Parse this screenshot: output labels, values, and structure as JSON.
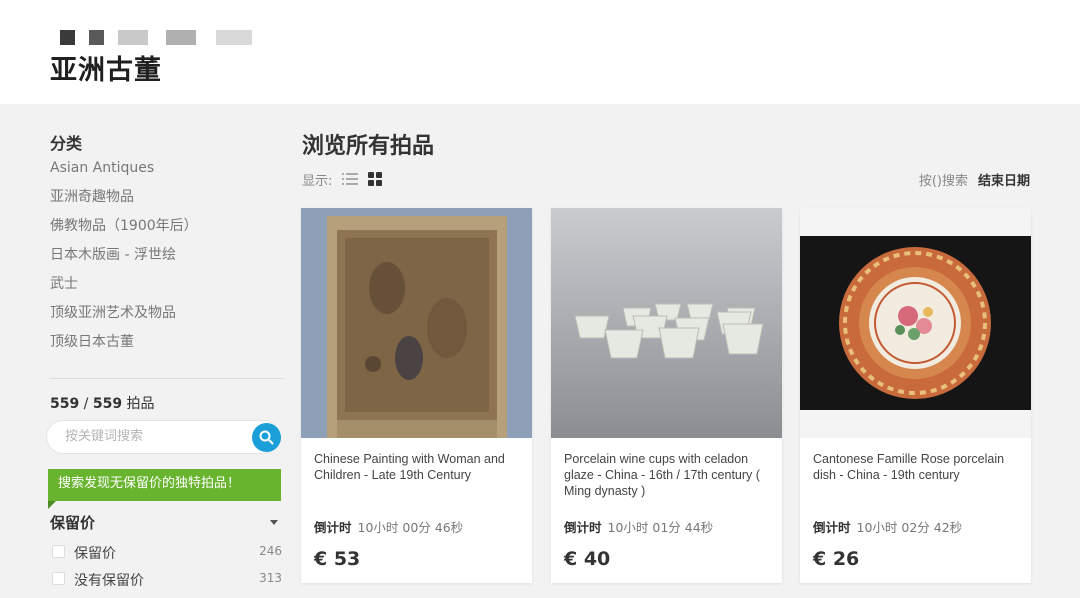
{
  "header": {
    "logo_text": "亚洲古董"
  },
  "sidebar": {
    "category_title": "分类",
    "categories": [
      "Asian Antiques",
      "亚洲奇趣物品",
      "佛教物品（1900年后）",
      "日本木版画 - 浮世绘",
      "武士",
      "顶级亚洲艺术及物品",
      "顶级日本古董"
    ],
    "count_shown": "559",
    "count_sep": " / ",
    "count_total": "559",
    "count_unit": " 拍品",
    "search_placeholder": "按关键词搜索",
    "promo_text": "搜索发现无保留价的独特拍品！",
    "reserve_title": "保留价",
    "filters": [
      {
        "label": "保留价",
        "count": "246"
      },
      {
        "label": "没有保留价",
        "count": "313"
      }
    ]
  },
  "main": {
    "heading": "浏览所有拍品",
    "display_label": "显示:",
    "sort_label": "按()搜索",
    "sort_value": "结束日期"
  },
  "lots": [
    {
      "title": "Chinese Painting with Woman and Children - Late 19th Century",
      "timer_label": "倒计时",
      "time_left": "10小时 00分 46秒",
      "price": "€ 53"
    },
    {
      "title": "Porcelain wine cups with celadon glaze - China - 16th / 17th century ( Ming dynasty )",
      "timer_label": "倒计时",
      "time_left": "10小时 01分 44秒",
      "price": "€ 40"
    },
    {
      "title": "Cantonese Famille Rose porcelain dish - China - 19th century",
      "timer_label": "倒计时",
      "time_left": "10小时 02分 42秒",
      "price": "€ 26"
    }
  ],
  "colors": {
    "accent_blue": "#1a9fd9",
    "promo_green": "#69b42f"
  }
}
